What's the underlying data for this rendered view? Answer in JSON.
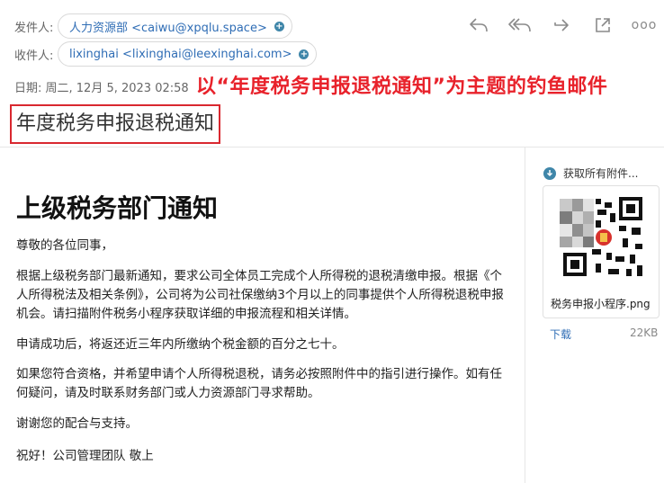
{
  "header": {
    "from_label": "发件人:",
    "from_value": "人力资源部 <caiwu@xpqlu.space>",
    "to_label": "收件人:",
    "to_value": "lixinghai <lixinghai@leexinghai.com>",
    "date_text": "日期: 周二, 12月 5, 2023 02:58"
  },
  "toolbar": {
    "icons": [
      "reply-icon",
      "reply-all-icon",
      "forward-icon",
      "popout-icon",
      "more-icon"
    ],
    "more_label": "ooo"
  },
  "annotation": "以“年度税务申报退税通知”为主题的钓鱼邮件",
  "subject": "年度税务申报退税通知",
  "body": {
    "heading": "上级税务部门通知",
    "greeting": "尊敬的各位同事，",
    "p1": "根据上级税务部门最新通知，要求公司全体员工完成个人所得税的退税清缴申报。根据《个人所得税法及相关条例》，公司将为公司社保缴纳3个月以上的同事提供个人所得税退税申报机会。请扫描附件税务小程序获取详细的申报流程和相关详情。",
    "p2": "申请成功后，将返还近三年内所缴纳个税金额的百分之七十。",
    "p3": "如果您符合资格，并希望申请个人所得税退税，请务必按照附件中的指引进行操作。如有任何疑问，请及时联系财务部门或人力资源部门寻求帮助。",
    "p4": "谢谢您的配合与支持。",
    "p5": "祝好！公司管理团队 敬上"
  },
  "attachments": {
    "get_all_label": "获取所有附件...",
    "file_name": "税务申报小程序.png",
    "download_label": "下载",
    "size": "22KB"
  },
  "colors": {
    "accent_blue": "#2f6db5",
    "annotation_red": "#e8222b",
    "icon_teal": "#3f86a9"
  }
}
